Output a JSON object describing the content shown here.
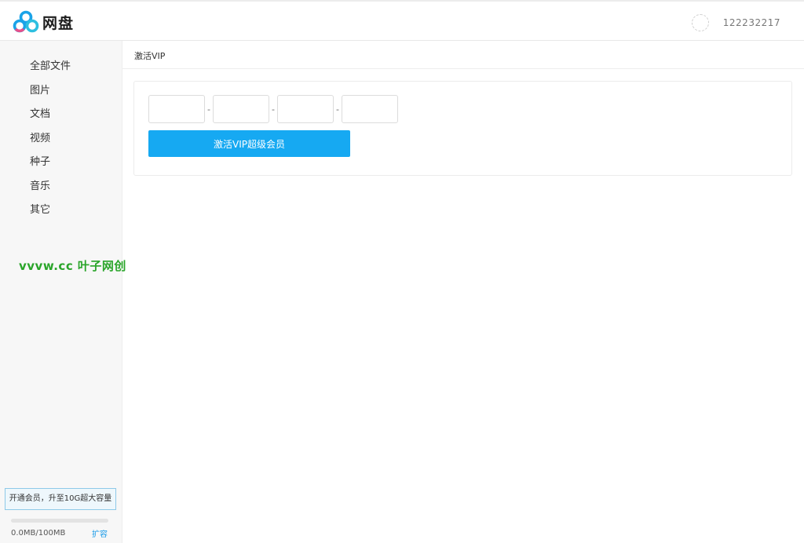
{
  "header": {
    "app_name": "网盘",
    "username": "122232217"
  },
  "sidebar": {
    "items": [
      {
        "label": "全部文件"
      },
      {
        "label": "图片"
      },
      {
        "label": "文档"
      },
      {
        "label": "视频"
      },
      {
        "label": "种子"
      },
      {
        "label": "音乐"
      },
      {
        "label": "其它"
      }
    ],
    "watermark": "vvvw.cc  叶子网创",
    "upgrade_label": "开通会员，升至10G超大容量",
    "storage_used_fraction": 0,
    "storage_text": "0.0MB/100MB",
    "expand_label": "扩容"
  },
  "main": {
    "breadcrumb": "激活VIP",
    "code_separators": [
      "-",
      "-",
      "-"
    ],
    "activate_button": "激活VIP超级会员"
  },
  "colors": {
    "accent": "#16a9f2",
    "watermark": "#2aa52a",
    "logo_blue": "#1aa3e8",
    "logo_pink": "#e8508a"
  },
  "icons": {
    "logo": "cloud-rings-logo-icon",
    "avatar": "user-avatar-icon"
  }
}
